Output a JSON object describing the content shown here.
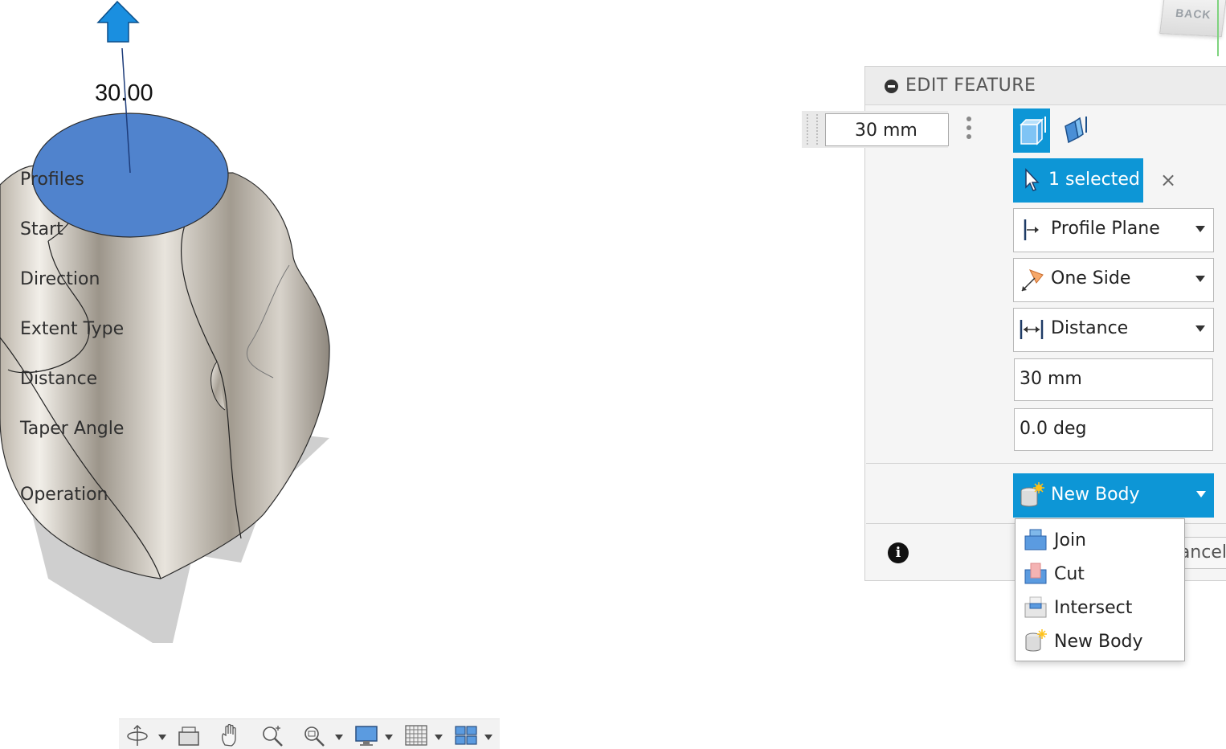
{
  "viewport": {
    "dimension_label": "30.00",
    "viewcube_label": "BACK"
  },
  "panel": {
    "title": "EDIT FEATURE",
    "floating_value": "30 mm",
    "rows": {
      "profiles": {
        "label": "Profiles",
        "value": "1 selected"
      },
      "start": {
        "label": "Start",
        "value": "Profile Plane"
      },
      "direction": {
        "label": "Direction",
        "value": "One Side"
      },
      "extent_type": {
        "label": "Extent Type",
        "value": "Distance"
      },
      "distance": {
        "label": "Distance",
        "value": "30 mm"
      },
      "taper_angle": {
        "label": "Taper Angle",
        "value": "0.0 deg"
      },
      "operation": {
        "label": "Operation",
        "value": "New Body"
      }
    },
    "cancel_label": "ancel"
  },
  "operation_menu": {
    "items": [
      "Join",
      "Cut",
      "Intersect",
      "New Body"
    ]
  },
  "icons": {
    "accent": "#0d96d6",
    "toolbar": [
      "orbit-icon",
      "look-at-icon",
      "pan-icon",
      "zoom-icon",
      "zoom-window-icon",
      "display-settings-icon",
      "grid-settings-icon",
      "viewports-icon"
    ]
  }
}
